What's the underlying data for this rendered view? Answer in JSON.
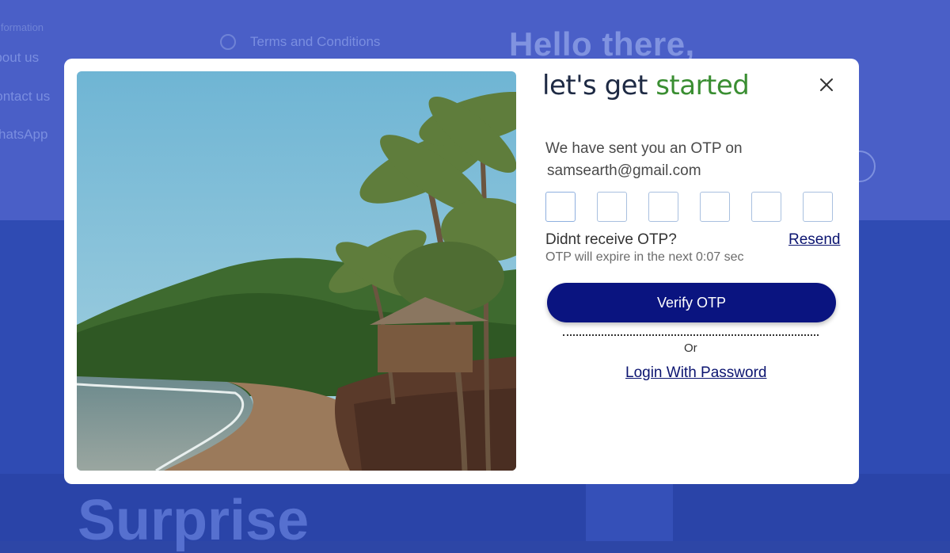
{
  "background": {
    "nav": {
      "section_heading": "Information",
      "links": [
        "About us",
        "Contact us",
        "WhatsApp"
      ],
      "terms_link": "Terms and Conditions"
    },
    "hero_heading": "Hello there,",
    "bottom_heading": "Surprise"
  },
  "modal": {
    "brand": {
      "part1": "let's get ",
      "part2": "started"
    },
    "close_icon": "close-icon",
    "otp_message": "We have sent you an OTP on",
    "email": "samsearth@gmail.com",
    "otp_length": 6,
    "didnt_receive": "Didnt receive OTP?",
    "resend_label": "Resend",
    "expire_text": "OTP will expire in the next 0:07 sec",
    "verify_label": "Verify OTP",
    "or_label": "Or",
    "login_password_label": "Login With Password"
  },
  "colors": {
    "primary": "#0a1480",
    "brand_green": "#3a8e32",
    "overlay_blue": "#3a52b8"
  }
}
